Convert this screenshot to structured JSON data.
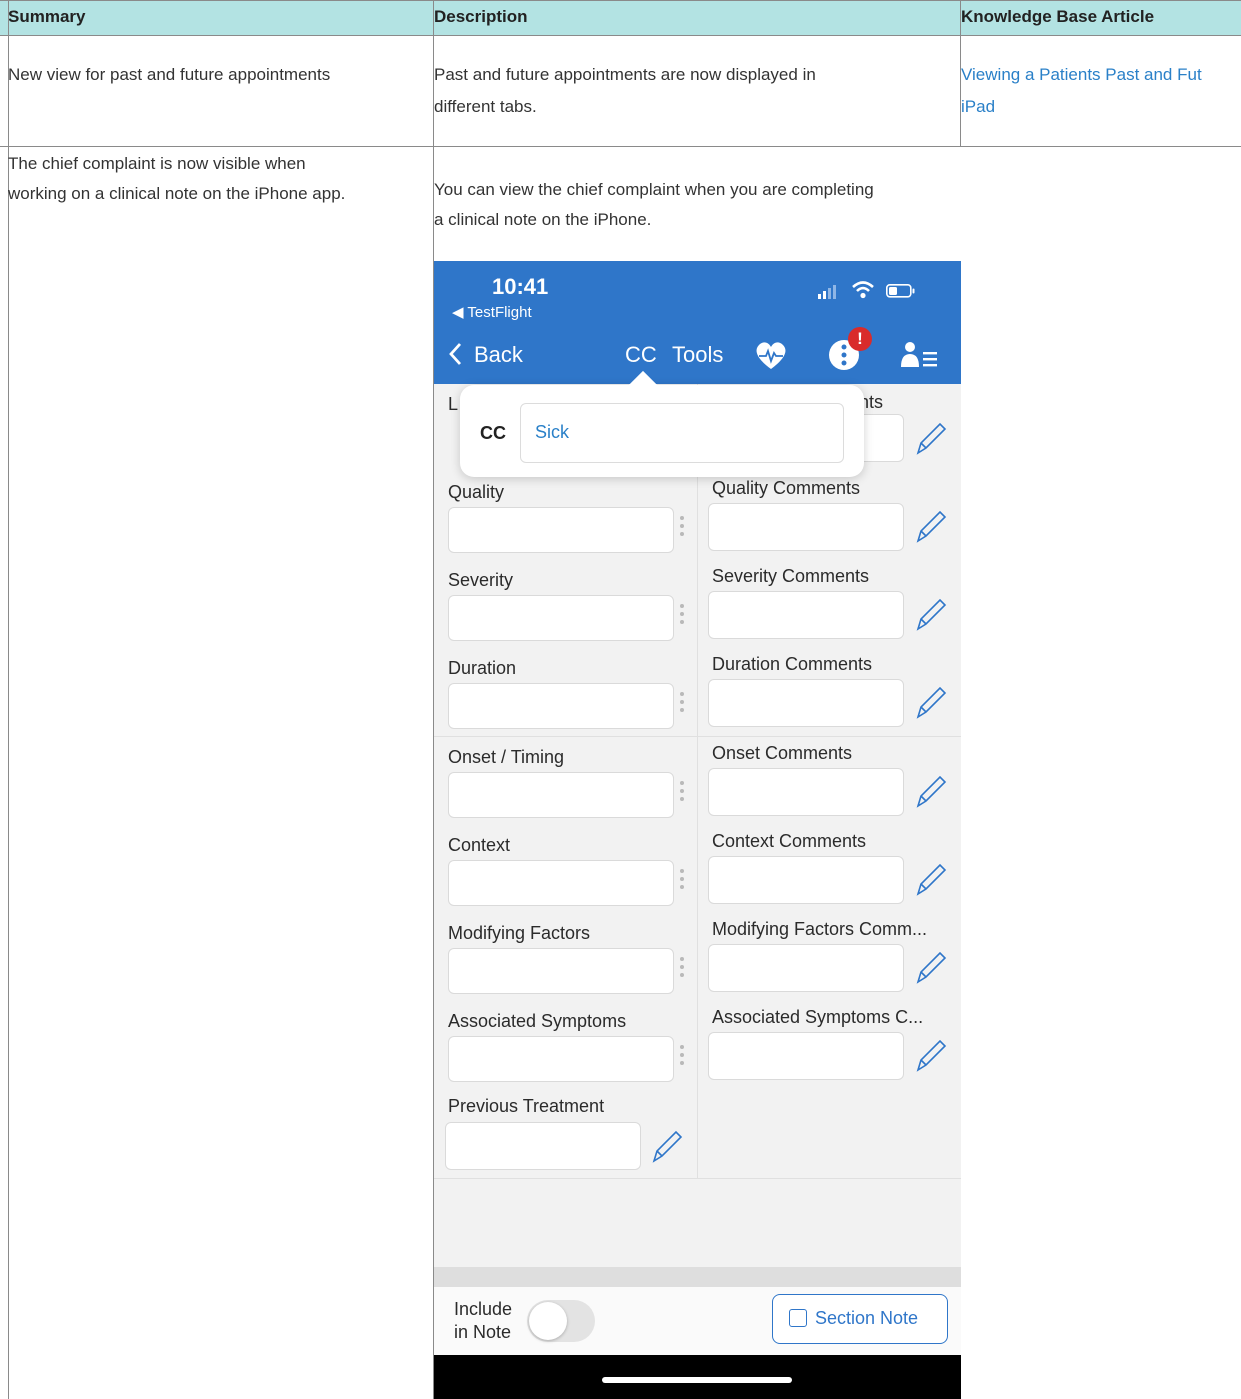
{
  "table": {
    "headers": [
      "Summary",
      "Description",
      "Knowledge Base Article"
    ],
    "rows": [
      {
        "summary": "New view for past and future appointments",
        "description_1": "Past and future appointments are now displayed in",
        "description_2": "different tabs.",
        "kb_1": "Viewing a Patients Past and Fut",
        "kb_2": "iPad"
      },
      {
        "summary_1": "The chief complaint is now visible when",
        "summary_2": "working on a clinical note on the iPhone app.",
        "description_1": "You can view the chief complaint when you are completing",
        "description_2": "a clinical note on the iPhone."
      }
    ]
  },
  "phone": {
    "status": {
      "time": "10:41",
      "back_app": "◀ TestFlight"
    },
    "nav": {
      "back": "Back",
      "cc": "CC",
      "tools": "Tools",
      "badge": "!"
    },
    "popover": {
      "label": "CC",
      "value": "Sick",
      "behind_left": "L",
      "behind_right": "nts"
    },
    "rows": [
      {
        "left": "Quality",
        "right": "Quality Comments"
      },
      {
        "left": "Severity",
        "right": "Severity Comments"
      },
      {
        "left": "Duration",
        "right": "Duration Comments"
      },
      {
        "left": "Onset / Timing",
        "right": "Onset Comments"
      },
      {
        "left": "Context",
        "right": "Context Comments"
      },
      {
        "left": "Modifying Factors",
        "right": "Modifying Factors Comm..."
      },
      {
        "left": "Associated Symptoms",
        "right": "Associated Symptoms C..."
      }
    ],
    "previous_treatment": "Previous Treatment",
    "footer": {
      "include_1": "Include",
      "include_2": "in Note",
      "section_note": "Section Note"
    },
    "colors": {
      "nav": "#2f76c9",
      "link": "#2a80c8",
      "badge": "#d92b2b"
    }
  }
}
